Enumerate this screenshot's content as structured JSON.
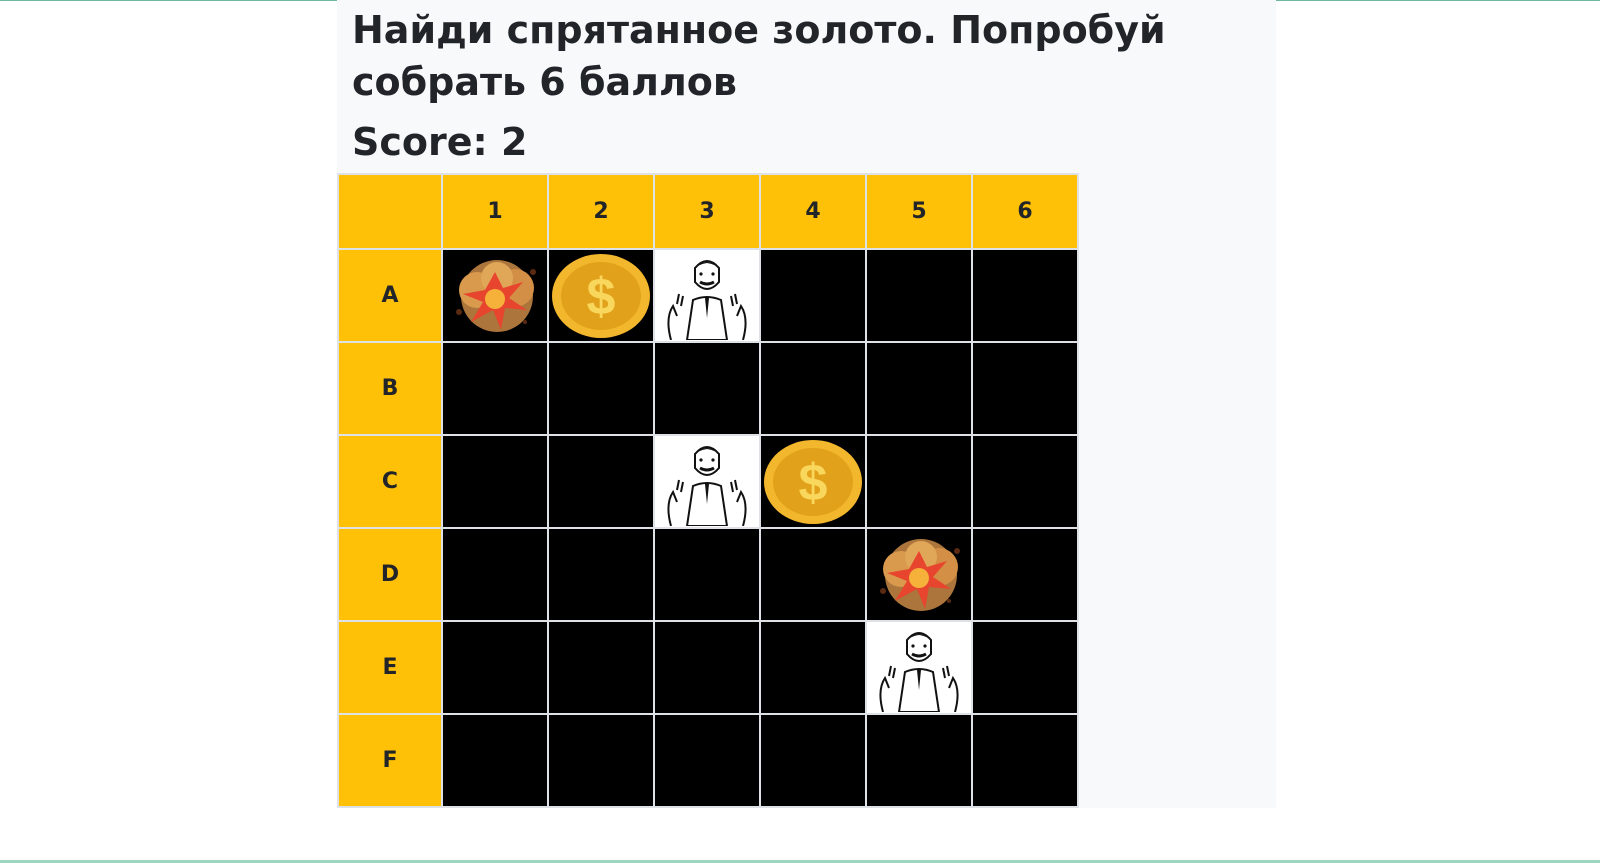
{
  "game": {
    "title": "Найди спрятанное золото. Попробуй собрать 6 баллов",
    "score_label": "Score: 2",
    "columns": [
      "1",
      "2",
      "3",
      "4",
      "5",
      "6"
    ],
    "rows": [
      {
        "label": "A",
        "cells": [
          "bomb",
          "coin",
          "man",
          "hidden",
          "hidden",
          "hidden"
        ]
      },
      {
        "label": "B",
        "cells": [
          "hidden",
          "hidden",
          "hidden",
          "hidden",
          "hidden",
          "hidden"
        ]
      },
      {
        "label": "C",
        "cells": [
          "hidden",
          "hidden",
          "man",
          "coin",
          "hidden",
          "hidden"
        ]
      },
      {
        "label": "D",
        "cells": [
          "hidden",
          "hidden",
          "hidden",
          "hidden",
          "bomb",
          "hidden"
        ]
      },
      {
        "label": "E",
        "cells": [
          "hidden",
          "hidden",
          "hidden",
          "hidden",
          "man",
          "hidden"
        ]
      },
      {
        "label": "F",
        "cells": [
          "hidden",
          "hidden",
          "hidden",
          "hidden",
          "hidden",
          "hidden"
        ]
      }
    ],
    "colors": {
      "header_bg": "#ffc107",
      "hidden_cell": "#000000",
      "coin_outer": "#f3b72d",
      "coin_inner": "#e2a11a",
      "explosion": "#e8452e"
    },
    "icons": {
      "bomb": "explosion-icon",
      "coin": "gold-coin-icon",
      "man": "not-bad-man-icon"
    }
  }
}
